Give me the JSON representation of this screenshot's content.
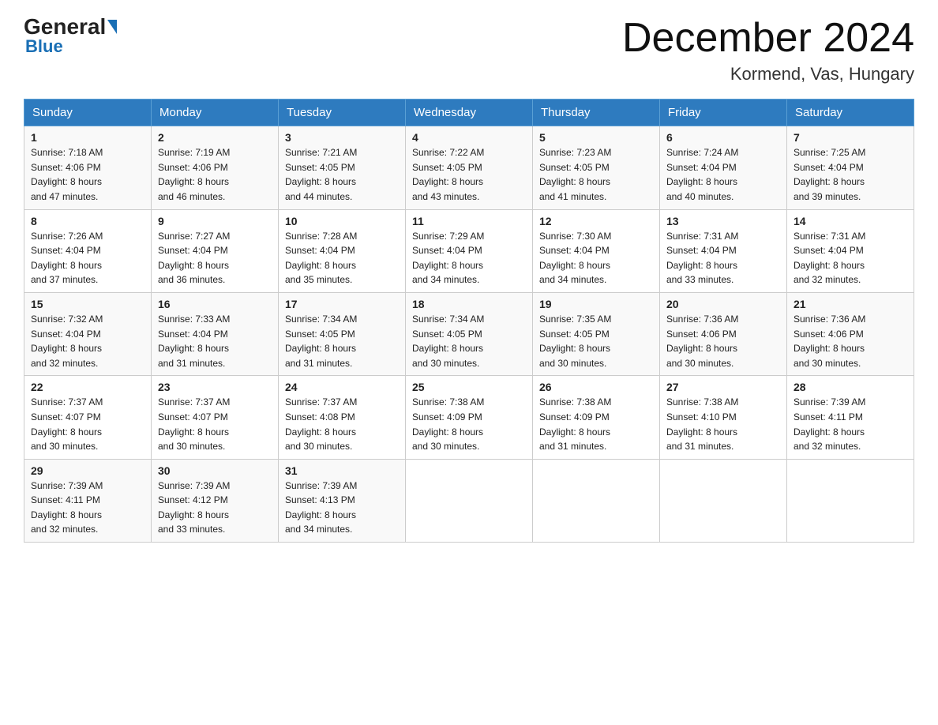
{
  "header": {
    "logo_general": "General",
    "logo_blue": "Blue",
    "month_year": "December 2024",
    "location": "Kormend, Vas, Hungary"
  },
  "weekdays": [
    "Sunday",
    "Monday",
    "Tuesday",
    "Wednesday",
    "Thursday",
    "Friday",
    "Saturday"
  ],
  "weeks": [
    [
      {
        "day": "1",
        "sunrise": "7:18 AM",
        "sunset": "4:06 PM",
        "daylight": "8 hours and 47 minutes."
      },
      {
        "day": "2",
        "sunrise": "7:19 AM",
        "sunset": "4:06 PM",
        "daylight": "8 hours and 46 minutes."
      },
      {
        "day": "3",
        "sunrise": "7:21 AM",
        "sunset": "4:05 PM",
        "daylight": "8 hours and 44 minutes."
      },
      {
        "day": "4",
        "sunrise": "7:22 AM",
        "sunset": "4:05 PM",
        "daylight": "8 hours and 43 minutes."
      },
      {
        "day": "5",
        "sunrise": "7:23 AM",
        "sunset": "4:05 PM",
        "daylight": "8 hours and 41 minutes."
      },
      {
        "day": "6",
        "sunrise": "7:24 AM",
        "sunset": "4:04 PM",
        "daylight": "8 hours and 40 minutes."
      },
      {
        "day": "7",
        "sunrise": "7:25 AM",
        "sunset": "4:04 PM",
        "daylight": "8 hours and 39 minutes."
      }
    ],
    [
      {
        "day": "8",
        "sunrise": "7:26 AM",
        "sunset": "4:04 PM",
        "daylight": "8 hours and 37 minutes."
      },
      {
        "day": "9",
        "sunrise": "7:27 AM",
        "sunset": "4:04 PM",
        "daylight": "8 hours and 36 minutes."
      },
      {
        "day": "10",
        "sunrise": "7:28 AM",
        "sunset": "4:04 PM",
        "daylight": "8 hours and 35 minutes."
      },
      {
        "day": "11",
        "sunrise": "7:29 AM",
        "sunset": "4:04 PM",
        "daylight": "8 hours and 34 minutes."
      },
      {
        "day": "12",
        "sunrise": "7:30 AM",
        "sunset": "4:04 PM",
        "daylight": "8 hours and 34 minutes."
      },
      {
        "day": "13",
        "sunrise": "7:31 AM",
        "sunset": "4:04 PM",
        "daylight": "8 hours and 33 minutes."
      },
      {
        "day": "14",
        "sunrise": "7:31 AM",
        "sunset": "4:04 PM",
        "daylight": "8 hours and 32 minutes."
      }
    ],
    [
      {
        "day": "15",
        "sunrise": "7:32 AM",
        "sunset": "4:04 PM",
        "daylight": "8 hours and 32 minutes."
      },
      {
        "day": "16",
        "sunrise": "7:33 AM",
        "sunset": "4:04 PM",
        "daylight": "8 hours and 31 minutes."
      },
      {
        "day": "17",
        "sunrise": "7:34 AM",
        "sunset": "4:05 PM",
        "daylight": "8 hours and 31 minutes."
      },
      {
        "day": "18",
        "sunrise": "7:34 AM",
        "sunset": "4:05 PM",
        "daylight": "8 hours and 30 minutes."
      },
      {
        "day": "19",
        "sunrise": "7:35 AM",
        "sunset": "4:05 PM",
        "daylight": "8 hours and 30 minutes."
      },
      {
        "day": "20",
        "sunrise": "7:36 AM",
        "sunset": "4:06 PM",
        "daylight": "8 hours and 30 minutes."
      },
      {
        "day": "21",
        "sunrise": "7:36 AM",
        "sunset": "4:06 PM",
        "daylight": "8 hours and 30 minutes."
      }
    ],
    [
      {
        "day": "22",
        "sunrise": "7:37 AM",
        "sunset": "4:07 PM",
        "daylight": "8 hours and 30 minutes."
      },
      {
        "day": "23",
        "sunrise": "7:37 AM",
        "sunset": "4:07 PM",
        "daylight": "8 hours and 30 minutes."
      },
      {
        "day": "24",
        "sunrise": "7:37 AM",
        "sunset": "4:08 PM",
        "daylight": "8 hours and 30 minutes."
      },
      {
        "day": "25",
        "sunrise": "7:38 AM",
        "sunset": "4:09 PM",
        "daylight": "8 hours and 30 minutes."
      },
      {
        "day": "26",
        "sunrise": "7:38 AM",
        "sunset": "4:09 PM",
        "daylight": "8 hours and 31 minutes."
      },
      {
        "day": "27",
        "sunrise": "7:38 AM",
        "sunset": "4:10 PM",
        "daylight": "8 hours and 31 minutes."
      },
      {
        "day": "28",
        "sunrise": "7:39 AM",
        "sunset": "4:11 PM",
        "daylight": "8 hours and 32 minutes."
      }
    ],
    [
      {
        "day": "29",
        "sunrise": "7:39 AM",
        "sunset": "4:11 PM",
        "daylight": "8 hours and 32 minutes."
      },
      {
        "day": "30",
        "sunrise": "7:39 AM",
        "sunset": "4:12 PM",
        "daylight": "8 hours and 33 minutes."
      },
      {
        "day": "31",
        "sunrise": "7:39 AM",
        "sunset": "4:13 PM",
        "daylight": "8 hours and 34 minutes."
      },
      null,
      null,
      null,
      null
    ]
  ],
  "labels": {
    "sunrise": "Sunrise:",
    "sunset": "Sunset:",
    "daylight": "Daylight:"
  }
}
